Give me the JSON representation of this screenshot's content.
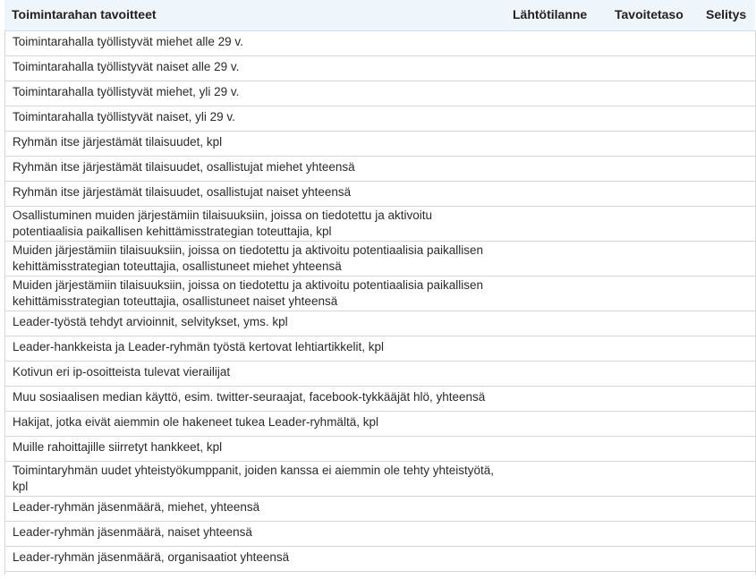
{
  "table": {
    "headers": {
      "goal": "Toimintarahan tavoitteet",
      "baseline": "Lähtötilanne",
      "target": "Tavoitetaso",
      "explanation": "Selitys"
    },
    "rows": [
      {
        "label": "Toimintarahalla työllistyvät miehet alle 29 v.",
        "baseline": "",
        "target": "",
        "explanation": ""
      },
      {
        "label": "Toimintarahalla työllistyvät naiset alle 29 v.",
        "baseline": "",
        "target": "",
        "explanation": ""
      },
      {
        "label": "Toimintarahalla työllistyvät miehet, yli 29 v.",
        "baseline": "",
        "target": "",
        "explanation": ""
      },
      {
        "label": "Toimintarahalla työllistyvät naiset, yli 29 v.",
        "baseline": "",
        "target": "",
        "explanation": ""
      },
      {
        "label": "Ryhmän itse järjestämät tilaisuudet, kpl",
        "baseline": "",
        "target": "",
        "explanation": ""
      },
      {
        "label": "Ryhmän itse järjestämät tilaisuudet, osallistujat miehet yhteensä",
        "baseline": "",
        "target": "",
        "explanation": ""
      },
      {
        "label": "Ryhmän itse järjestämät tilaisuudet, osallistujat naiset yhteensä",
        "baseline": "",
        "target": "",
        "explanation": ""
      },
      {
        "label": "Osallistuminen muiden järjestämiin tilaisuuksiin, joissa on tiedotettu ja aktivoitu potentiaalisia paikallisen kehittämisstrategian toteuttajia, kpl",
        "baseline": "",
        "target": "",
        "explanation": ""
      },
      {
        "label": "Muiden järjestämiin tilaisuuksiin, joissa on tiedotettu ja aktivoitu potentiaalisia paikallisen kehittämisstrategian toteuttajia, osallistuneet miehet yhteensä",
        "baseline": "",
        "target": "",
        "explanation": ""
      },
      {
        "label": "Muiden järjestämiin tilaisuuksiin, joissa on tiedotettu ja aktivoitu potentiaalisia paikallisen kehittämisstrategian toteuttajia, osallistuneet naiset yhteensä",
        "baseline": "",
        "target": "",
        "explanation": ""
      },
      {
        "label": "Leader-työstä tehdyt arvioinnit, selvitykset, yms. kpl",
        "baseline": "",
        "target": "",
        "explanation": ""
      },
      {
        "label": "Leader-hankkeista ja Leader-ryhmän työstä kertovat lehtiartikkelit, kpl",
        "baseline": "",
        "target": "",
        "explanation": ""
      },
      {
        "label": "Kotivun eri ip-osoitteista tulevat vierailijat",
        "baseline": "",
        "target": "",
        "explanation": ""
      },
      {
        "label": "Muu sosiaalisen median käyttö, esim. twitter-seuraajat, facebook-tykkääjät hlö, yhteensä",
        "baseline": "",
        "target": "",
        "explanation": ""
      },
      {
        "label": "Hakijat, jotka eivät aiemmin ole hakeneet tukea Leader-ryhmältä, kpl",
        "baseline": "",
        "target": "",
        "explanation": ""
      },
      {
        "label": "Muille rahoittajille siirretyt hankkeet, kpl",
        "baseline": "",
        "target": "",
        "explanation": ""
      },
      {
        "label": "Toimintaryhmän uudet yhteistyökumppanit, joiden kanssa ei aiemmin ole tehty yhteistyötä, kpl",
        "baseline": "",
        "target": "",
        "explanation": ""
      },
      {
        "label": "Leader-ryhmän jäsenmäärä, miehet, yhteensä",
        "baseline": "",
        "target": "",
        "explanation": ""
      },
      {
        "label": "Leader-ryhmän jäsenmäärä, naiset yhteensä",
        "baseline": "",
        "target": "",
        "explanation": ""
      },
      {
        "label": "Leader-ryhmän jäsenmäärä, organisaatiot yhteensä",
        "baseline": "",
        "target": "",
        "explanation": ""
      }
    ]
  },
  "colors": {
    "header_background": "#eef5fb",
    "row_border": "#d6d6d6",
    "text": "#222222"
  }
}
